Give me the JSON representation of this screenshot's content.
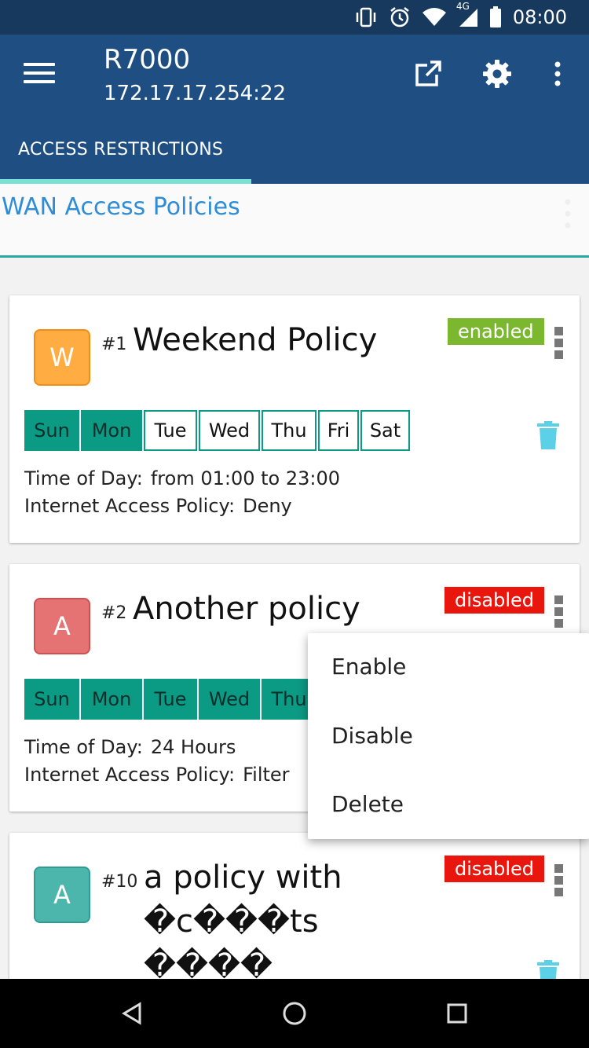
{
  "status_bar": {
    "time": "08:00",
    "network_label": "4G",
    "icons": [
      "vibrate-icon",
      "alarm-icon",
      "wifi-icon",
      "cellular-signal-icon",
      "battery-icon"
    ]
  },
  "app_bar": {
    "title": "R7000",
    "subtitle": "172.17.17.254:22",
    "icons": [
      "menu-icon",
      "open-external-icon",
      "settings-gear-icon",
      "more-vert-icon"
    ],
    "color": "#1f4f82"
  },
  "tabs": [
    {
      "label": "ACCESS RESTRICTIONS",
      "selected": true
    }
  ],
  "section": {
    "title": "WAN Access Policies"
  },
  "policies": [
    {
      "avatar_letter": "W",
      "avatar_color": "#ffad42",
      "number": "#1",
      "name": "Weekend Policy",
      "name_line2": "",
      "name_line3": "",
      "status": "enabled",
      "status_color": "#7cb82f",
      "days": [
        {
          "label": "Sun",
          "active": true
        },
        {
          "label": "Mon",
          "active": true
        },
        {
          "label": "Tue",
          "active": false
        },
        {
          "label": "Wed",
          "active": false
        },
        {
          "label": "Thu",
          "active": false
        },
        {
          "label": "Fri",
          "active": false
        },
        {
          "label": "Sat",
          "active": false
        }
      ],
      "time_label": "Time of Day:",
      "time_value": "from 01:00 to 23:00",
      "policy_label": "Internet Access Policy:",
      "policy_value": "Deny"
    },
    {
      "avatar_letter": "A",
      "avatar_color": "#e57373",
      "number": "#2",
      "name": "Another policy",
      "status": "disabled",
      "status_color": "#e8160c",
      "days": [
        {
          "label": "Sun",
          "active": true
        },
        {
          "label": "Mon",
          "active": true
        },
        {
          "label": "Tue",
          "active": true
        },
        {
          "label": "Wed",
          "active": true
        },
        {
          "label": "Thu",
          "active": true
        }
      ],
      "time_label": "Time of Day:",
      "time_value": "24 Hours",
      "policy_label": "Internet Access Policy:",
      "policy_value": "Filter"
    },
    {
      "avatar_letter": "A",
      "avatar_color": "#4db6ac",
      "number": "#10",
      "name": "a policy with",
      "name_line2": "�c���ts",
      "name_line3": "����",
      "status": "disabled",
      "status_color": "#e8160c"
    }
  ],
  "popup_menu": {
    "items": [
      "Enable",
      "Disable",
      "Delete"
    ]
  },
  "nav_bar": {
    "icons": [
      "back-icon",
      "home-icon",
      "recents-icon"
    ]
  }
}
